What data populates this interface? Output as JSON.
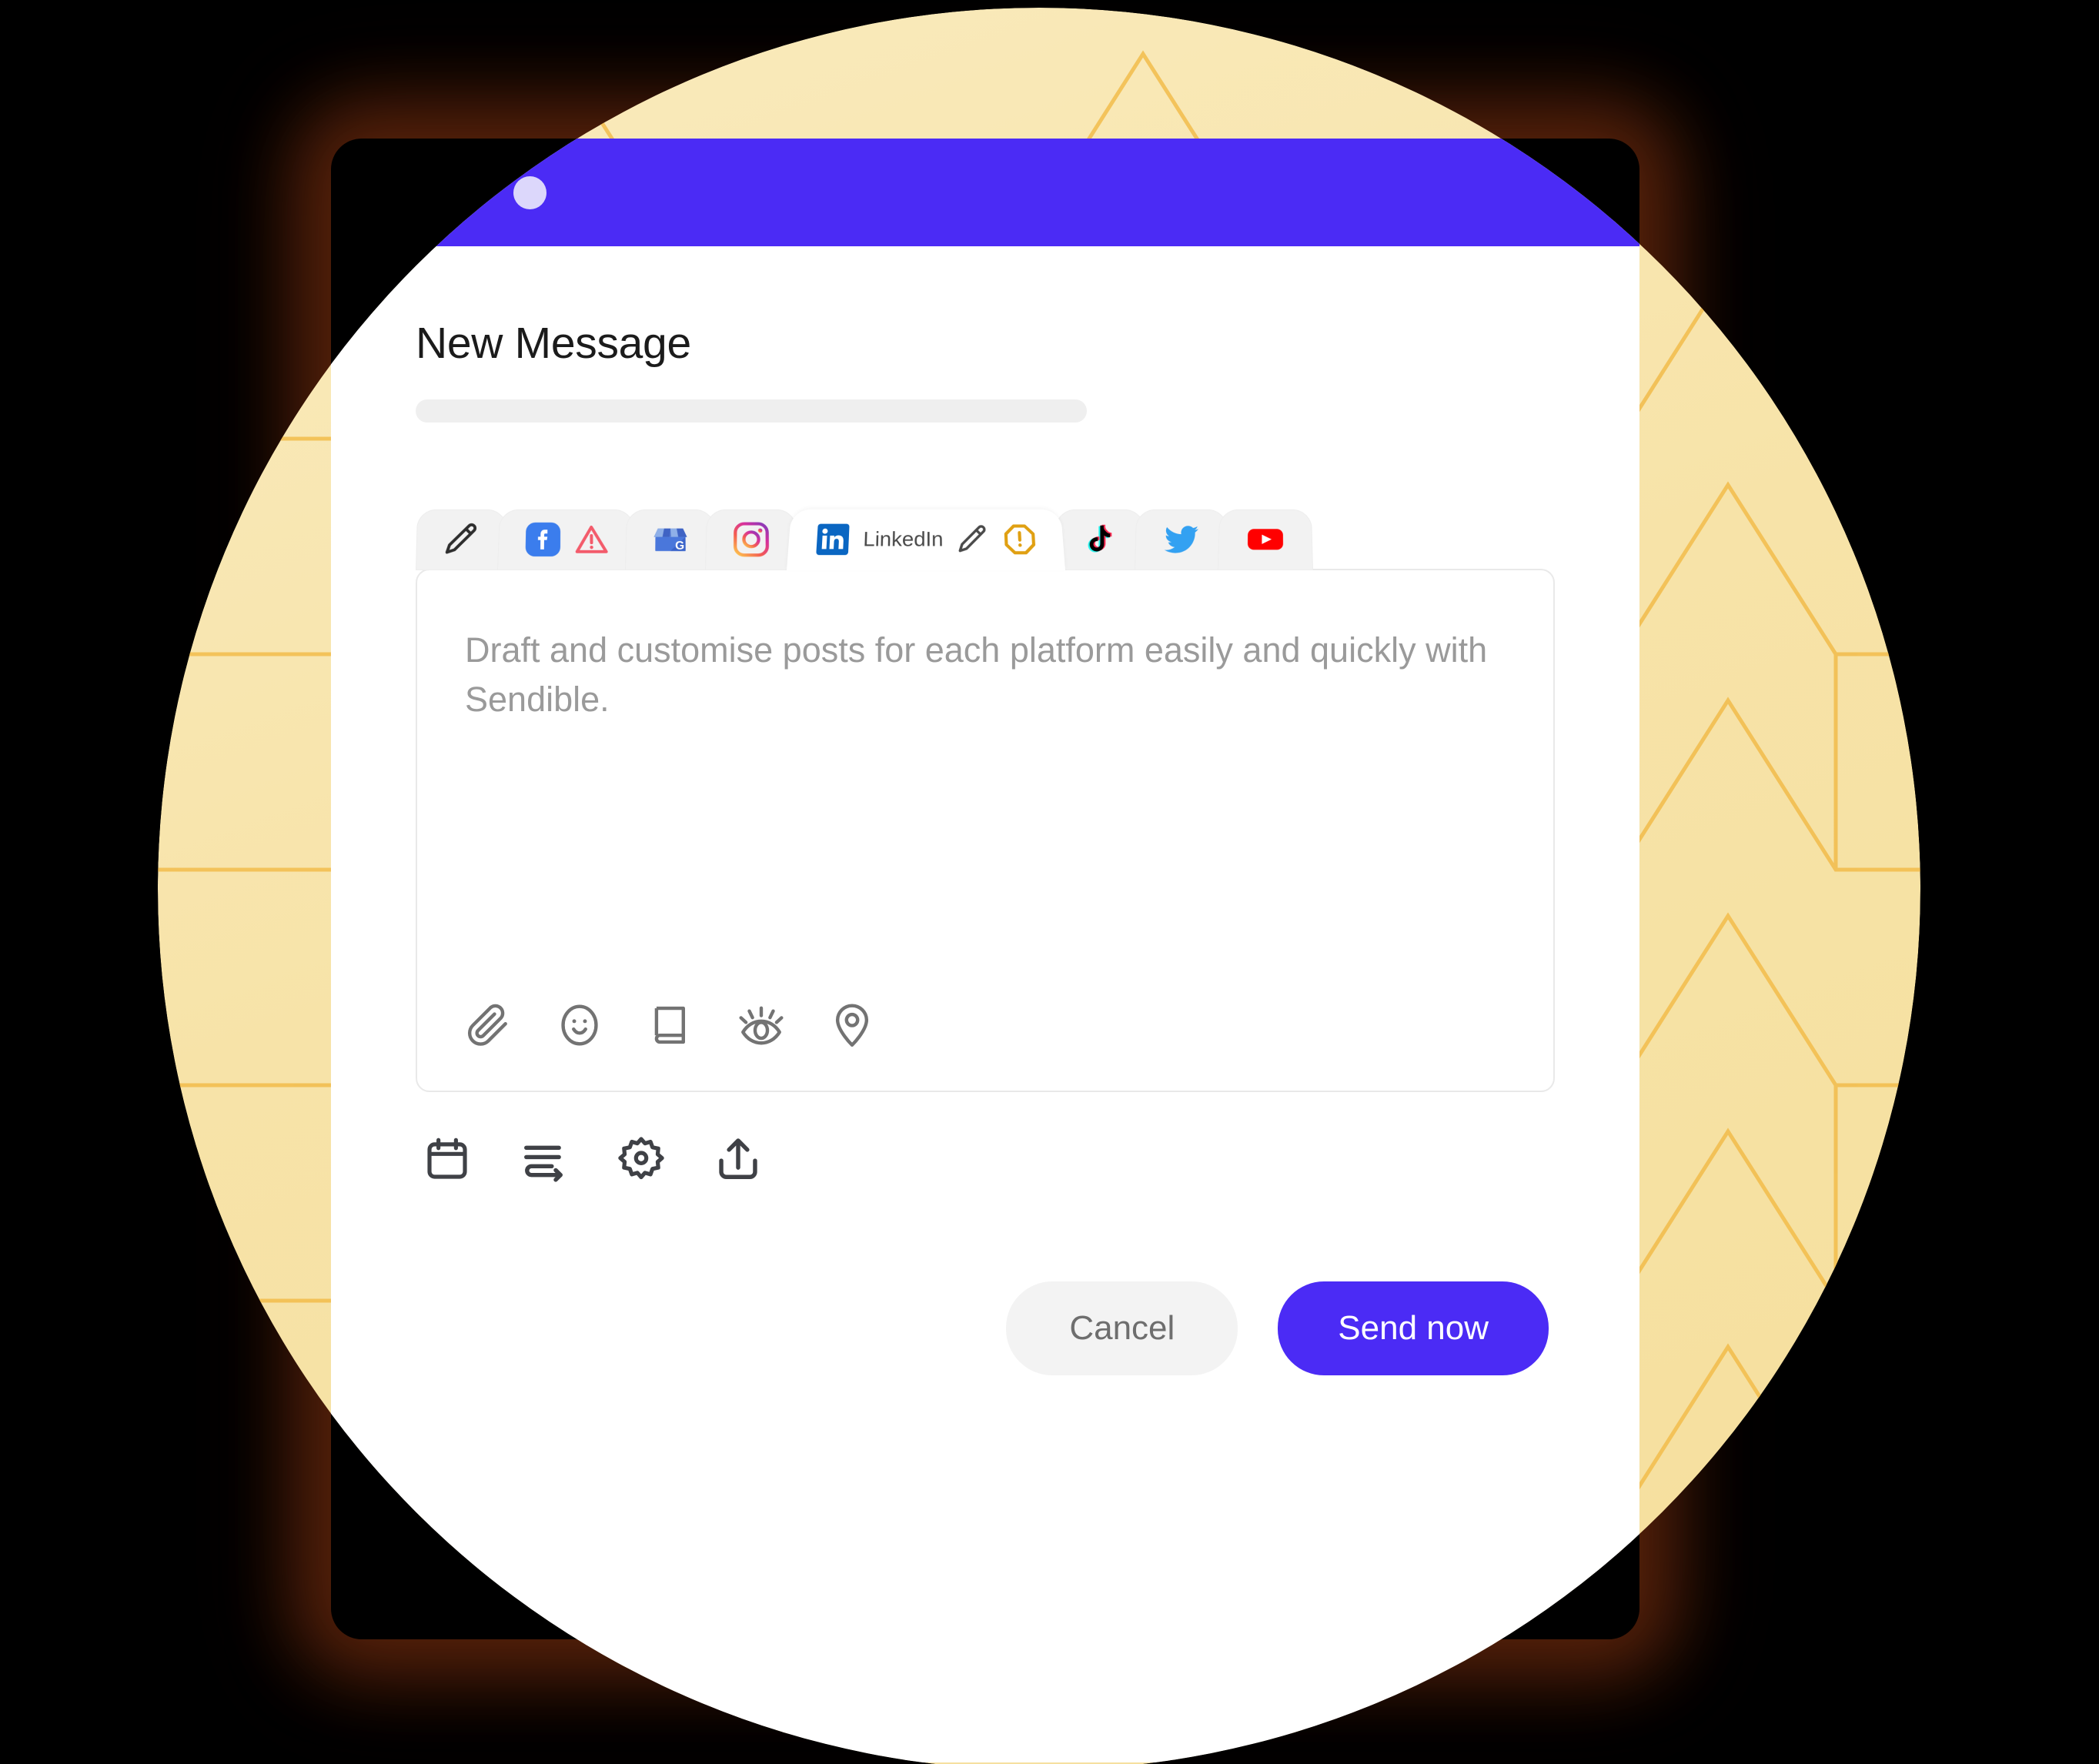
{
  "window": {
    "title_dots": 3,
    "accent_color": "#4B2BF5"
  },
  "header": {
    "page_title": "New Message"
  },
  "tabs": [
    {
      "id": "compose",
      "label": "",
      "icon": "pencil-icon",
      "active": false,
      "badge": ""
    },
    {
      "id": "facebook",
      "label": "",
      "icon": "facebook-icon",
      "active": false,
      "badge": "warning-triangle-icon"
    },
    {
      "id": "google",
      "label": "",
      "icon": "google-business-icon",
      "active": false,
      "badge": ""
    },
    {
      "id": "instagram",
      "label": "",
      "icon": "instagram-icon",
      "active": false,
      "badge": ""
    },
    {
      "id": "linkedin",
      "label": "LinkedIn",
      "icon": "linkedin-icon",
      "active": true,
      "badge": "warning-octagon-icon"
    },
    {
      "id": "tiktok",
      "label": "",
      "icon": "tiktok-icon",
      "active": false,
      "badge": ""
    },
    {
      "id": "twitter",
      "label": "",
      "icon": "twitter-icon",
      "active": false,
      "badge": ""
    },
    {
      "id": "youtube",
      "label": "",
      "icon": "youtube-icon",
      "active": false,
      "badge": ""
    }
  ],
  "composer": {
    "placeholder": "Draft and customise posts for each platform easily and quickly with Sendible.",
    "value": "",
    "tools": [
      {
        "name": "attachment-icon",
        "label": "Attach file"
      },
      {
        "name": "emoji-icon",
        "label": "Emoji"
      },
      {
        "name": "library-icon",
        "label": "Media library"
      },
      {
        "name": "preview-icon",
        "label": "Preview"
      },
      {
        "name": "location-icon",
        "label": "Location"
      }
    ]
  },
  "actions": [
    {
      "name": "calendar-icon",
      "label": "Schedule"
    },
    {
      "name": "queue-icon",
      "label": "Add to queue"
    },
    {
      "name": "settings-icon",
      "label": "Settings"
    },
    {
      "name": "upload-icon",
      "label": "Share"
    }
  ],
  "footer": {
    "cancel_label": "Cancel",
    "send_label": "Send now"
  },
  "colors": {
    "accent": "#4B2BF5",
    "disc": "#F7E3A8",
    "pattern_line": "#F2BC4B",
    "background": "#000000",
    "facebook": "#3B7DED",
    "linkedin": "#0A66C2",
    "twitter": "#33A1F2",
    "youtube": "#FF0000",
    "warning_red": "#F35B6B",
    "warning_orange": "#E0A012"
  }
}
